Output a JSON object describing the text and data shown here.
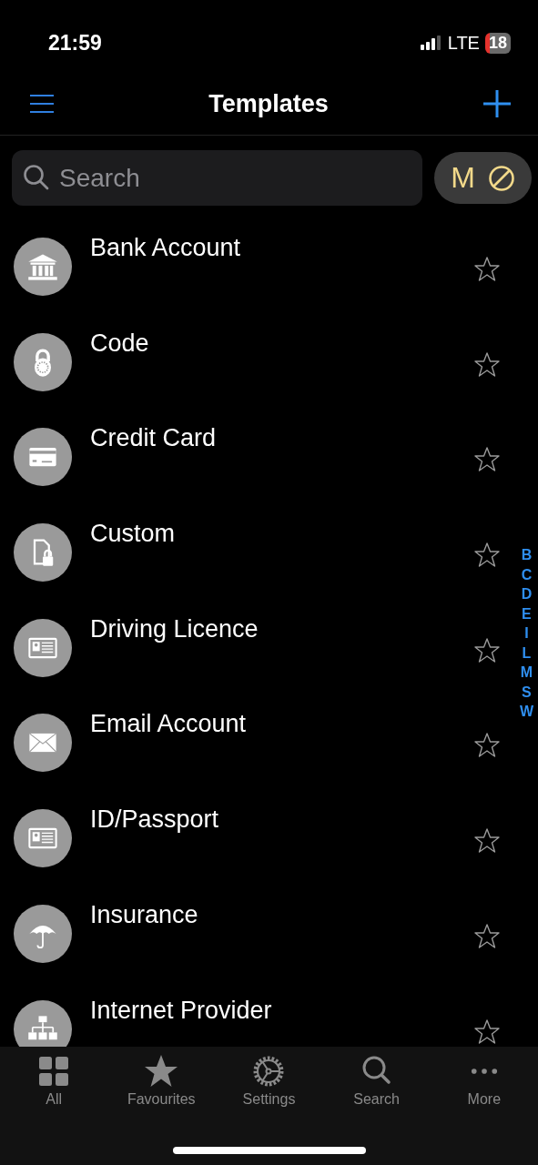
{
  "status_bar": {
    "time": "21:59",
    "network": "LTE",
    "battery": "18"
  },
  "nav_bar": {
    "title": "Templates"
  },
  "search": {
    "placeholder": "Search"
  },
  "filter_button": {
    "label": "M"
  },
  "templates": [
    {
      "name": "Bank Account",
      "favourite": false
    },
    {
      "name": "Code",
      "favourite": false
    },
    {
      "name": "Credit Card",
      "favourite": false
    },
    {
      "name": "Custom",
      "favourite": false
    },
    {
      "name": "Driving Licence",
      "favourite": false
    },
    {
      "name": "Email Account",
      "favourite": false
    },
    {
      "name": "ID/Passport",
      "favourite": false
    },
    {
      "name": "Insurance",
      "favourite": false
    },
    {
      "name": "Internet Provider",
      "favourite": false
    }
  ],
  "index_letters": [
    "B",
    "C",
    "D",
    "E",
    "I",
    "L",
    "M",
    "S",
    "W"
  ],
  "tab_bar": [
    {
      "label": "All",
      "selected": false
    },
    {
      "label": "Favourites",
      "selected": false
    },
    {
      "label": "Settings",
      "selected": false
    },
    {
      "label": "Search",
      "selected": false
    },
    {
      "label": "More",
      "selected": false
    }
  ]
}
